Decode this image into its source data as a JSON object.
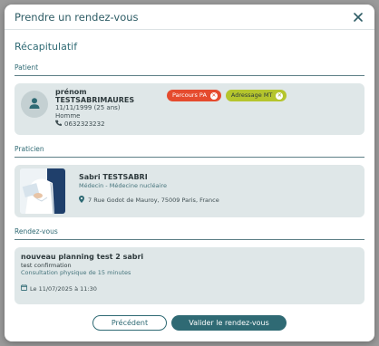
{
  "modal": {
    "title": "Prendre un rendez-vous",
    "recap_title": "Récapitulatif"
  },
  "patient": {
    "section_label": "Patient",
    "first_name": "prénom",
    "last_name": "TESTSABRIMAURES",
    "birth": "11/11/1999 (25 ans)",
    "gender": "Homme",
    "phone": "0632323232",
    "badges": [
      {
        "label": "Parcours PA",
        "color": "#e54b2e"
      },
      {
        "label": "Adressage MT",
        "color": "#b5c52d"
      }
    ]
  },
  "praticien": {
    "section_label": "Praticien",
    "name": "Sabri TESTSABRI",
    "specialty": "Médecin - Médecine nucléaire",
    "address": "7 Rue Godot de Mauroy, 75009 Paris, France"
  },
  "rdv": {
    "section_label": "Rendez-vous",
    "title": "nouveau planning test 2 sabri",
    "subtitle": "test confirmation",
    "type": "Consultation physique de 15 minutes",
    "date": "Le 11/07/2025 à 11:30"
  },
  "footer": {
    "prev_label": "Précédent",
    "validate_label": "Valider le rendez-vous"
  },
  "colors": {
    "accent": "#2f6a74",
    "card_bg": "#dfe7e8",
    "badge_pa": "#e54b2e",
    "badge_mt": "#b5c52d"
  }
}
